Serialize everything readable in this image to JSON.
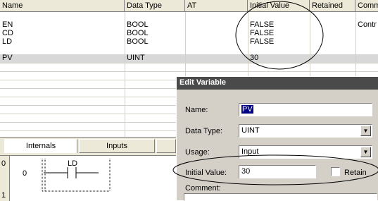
{
  "table": {
    "columns": [
      "Name",
      "Data Type",
      "AT",
      "Initial Value",
      "Retained",
      "Comm"
    ],
    "rows": [
      {
        "name": "EN",
        "type": "BOOL",
        "at": "",
        "init": "FALSE",
        "retained": "",
        "comment": "Contr"
      },
      {
        "name": "CD",
        "type": "BOOL",
        "at": "",
        "init": "FALSE",
        "retained": "",
        "comment": ""
      },
      {
        "name": "LD",
        "type": "BOOL",
        "at": "",
        "init": "FALSE",
        "retained": "",
        "comment": ""
      },
      {
        "name": "PV",
        "type": "UINT",
        "at": "",
        "init": "30",
        "retained": "",
        "comment": ""
      }
    ]
  },
  "tabs": [
    {
      "label": "Internals"
    },
    {
      "label": "Inputs"
    },
    {
      "label": ""
    }
  ],
  "ladder": {
    "rung0": "0",
    "rung0_sub": "0",
    "contact_label": "LD",
    "rung1": "1"
  },
  "dialog": {
    "title": "Edit Variable",
    "name_label": "Name:",
    "name_value": "PV",
    "type_label": "Data Type:",
    "type_value": "UINT",
    "usage_label": "Usage:",
    "usage_value": "Input",
    "init_label": "Initial Value:",
    "init_value": "30",
    "retain_label": "Retain",
    "comment_label": "Comment:"
  },
  "icons": {
    "dropdown": "chevron-down-icon"
  },
  "colors": {
    "title_bar": "#4a4a4a",
    "selected_row": "#d8d8d8",
    "dialog_bg": "#d4d0c8"
  }
}
